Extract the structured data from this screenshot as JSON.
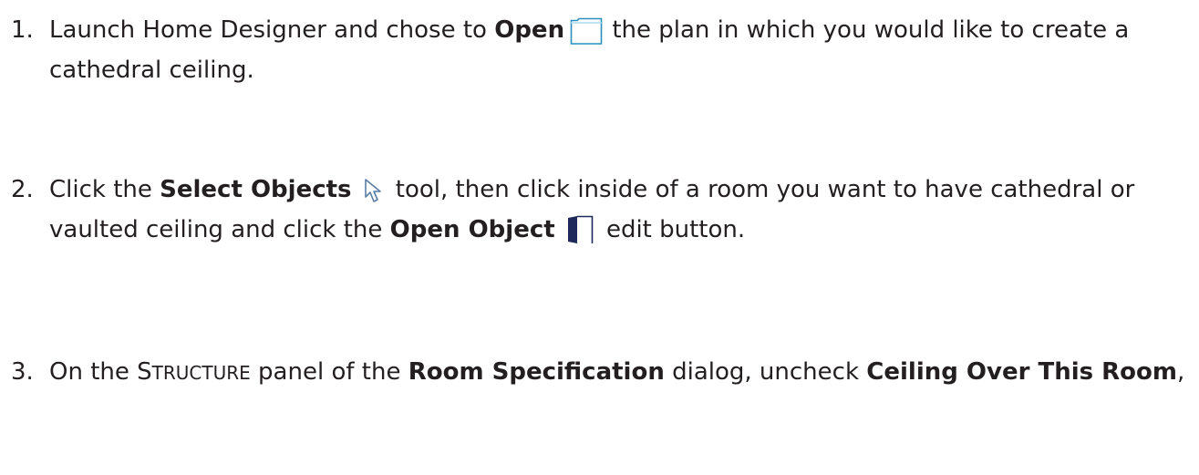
{
  "steps": [
    {
      "number": "1.",
      "t1": "Launch Home Designer and chose to ",
      "b1": "Open",
      "t2": " the plan in which you would like to create a cathedral ceiling.",
      "icon": "open-folder-icon"
    },
    {
      "number": "2.",
      "t1": "Click the ",
      "b1": "Select Objects",
      "t2": " tool, then click inside of a room you want to have cathedral or vaulted ceiling and click the ",
      "b2": "Open Object",
      "t3": " edit button.",
      "icon1": "select-arrow-icon",
      "icon2": "open-object-icon"
    },
    {
      "number": "3.",
      "t1": "On the ",
      "sc_first": "S",
      "sc_rest": "TRUCTURE",
      "t2": " panel of the ",
      "b1": "Room Specification",
      "t3": " dialog, uncheck ",
      "b2": "Ceiling Over This Room",
      "t4": ","
    }
  ]
}
